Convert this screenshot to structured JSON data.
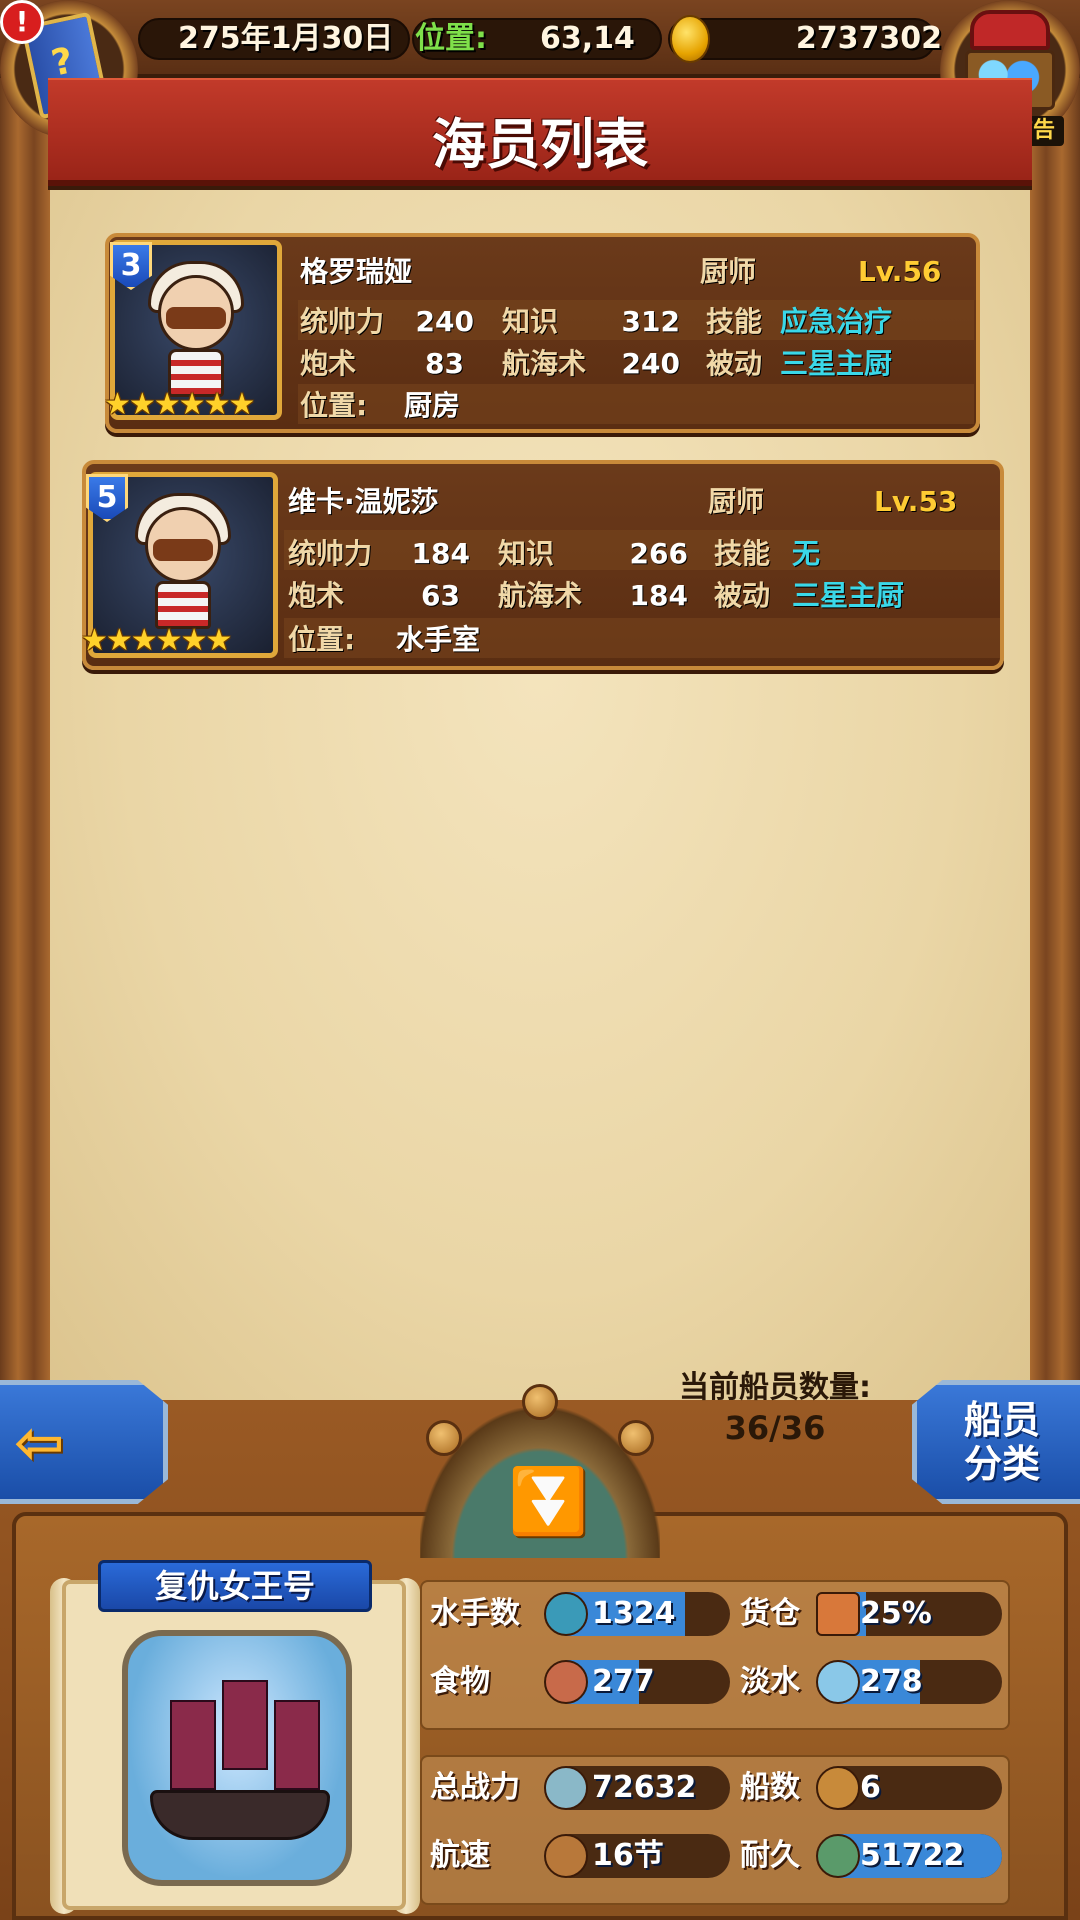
{
  "top_bar": {
    "date": "275年1月30日",
    "position_label": "位置:",
    "position_value": "63,14",
    "gold": "2737302",
    "alert_mark": "!",
    "ad_label": "有新广告"
  },
  "title": "海员列表",
  "crew": [
    {
      "rank": "3",
      "name": "格罗瑞娅",
      "job": "厨师",
      "level": "Lv.56",
      "leadership_label": "统帅力",
      "leadership": "240",
      "knowledge_label": "知识",
      "knowledge": "312",
      "skill_label": "技能",
      "skill": "应急治疗",
      "gunnery_label": "炮术",
      "gunnery": "83",
      "navigation_label": "航海术",
      "navigation": "240",
      "passive_label": "被动",
      "passive": "三星主厨",
      "location_label": "位置:",
      "location": "厨房",
      "stars": "★★★★★★"
    },
    {
      "rank": "5",
      "name": "维卡·温妮莎",
      "job": "厨师",
      "level": "Lv.53",
      "leadership_label": "统帅力",
      "leadership": "184",
      "knowledge_label": "知识",
      "knowledge": "266",
      "skill_label": "技能",
      "skill": "无",
      "gunnery_label": "炮术",
      "gunnery": "63",
      "navigation_label": "航海术",
      "navigation": "184",
      "passive_label": "被动",
      "passive": "三星主厨",
      "location_label": "位置:",
      "location": "水手室",
      "stars": "★★★★★★"
    }
  ],
  "crew_count": {
    "label": "当前船员数量:",
    "value": "36/36"
  },
  "nav": {
    "back_arrow": "⇦",
    "category_button": "船员\n分类",
    "collapse_arrow": "⏬"
  },
  "ship": {
    "name": "复仇女王号",
    "stats": {
      "sailors_label": "水手数",
      "sailors": "1324",
      "sailors_fill": 0.75,
      "cargo_label": "货仓",
      "cargo": "25%",
      "cargo_fill": 0.25,
      "food_label": "食物",
      "food": "277",
      "food_fill": 0.5,
      "water_label": "淡水",
      "water": "278",
      "water_fill": 0.55,
      "power_label": "总战力",
      "power": "72632",
      "ships_label": "船数",
      "ships": "6",
      "speed_label": "航速",
      "speed": "16节",
      "durability_label": "耐久",
      "durability": "51722",
      "durability_fill": 1.0
    }
  },
  "colors": {
    "skill_text": "#3ad8e8",
    "level_text": "#ffcc33",
    "bar_fill": "#3a88d8",
    "position_label": "#7fe04a"
  },
  "icons": {
    "book": "question-book-icon",
    "chest": "treasure-chest-icon",
    "coin": "gold-coin-icon",
    "sailor": "sailor-icon",
    "cargo": "crate-icon",
    "food": "meat-icon",
    "water": "water-jug-icon",
    "power": "crossed-swords-skull-icon",
    "ships": "sail-ship-icon",
    "speed": "boat-icon",
    "durability": "ship-wheel-icon"
  }
}
